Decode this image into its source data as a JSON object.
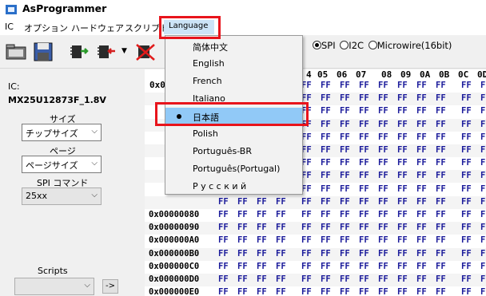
{
  "window": {
    "title": "AsProgrammer"
  },
  "menubar": {
    "items": [
      {
        "label": "IC"
      },
      {
        "label": "オプション"
      },
      {
        "label": "ハードウェア"
      },
      {
        "label": "スクリプト"
      }
    ],
    "language_label": "Language"
  },
  "language_menu": {
    "items": [
      {
        "label": "简体中文",
        "selected": false
      },
      {
        "label": "English",
        "selected": false
      },
      {
        "label": "French",
        "selected": false
      },
      {
        "label": "Italiano",
        "selected": false
      },
      {
        "label": "日本語",
        "selected": true
      },
      {
        "label": "Polish",
        "selected": false
      },
      {
        "label": "Português-BR",
        "selected": false
      },
      {
        "label": "Português(Portugal)",
        "selected": false
      },
      {
        "label": "Р у с с к и й",
        "selected": false
      }
    ]
  },
  "protocol": {
    "options": [
      {
        "label": "SPI",
        "checked": true
      },
      {
        "label": "I2C",
        "checked": false
      },
      {
        "label": "Microwire(16bit)",
        "checked": false
      }
    ]
  },
  "left_panel": {
    "ic_label": "IC:",
    "ic_name": "MX25U12873F_1.8V",
    "size_label": "サイズ",
    "size_value": "チップサイズ",
    "page_label": "ページ",
    "page_value": "ページサイズ",
    "spi_cmd_label": "SPI コマンド",
    "spi_cmd_value": "25xx",
    "scripts_label": "Scripts",
    "scripts_value": "",
    "run_label": "->"
  },
  "hex": {
    "partial_first_addr": "0x0",
    "header_visible": [
      "4",
      "05",
      "06",
      "07",
      "08",
      "09",
      "0A",
      "0B",
      "0C",
      "0D"
    ],
    "visible_addresses": [
      "0x00000080",
      "0x00000090",
      "0x000000A0",
      "0x000000B0",
      "0x000000C0",
      "0x000000D0",
      "0x000000E0"
    ],
    "byte_value": "FF"
  },
  "colors": {
    "highlight_red": "#e8141c",
    "selection_blue": "#91c9f7",
    "menu_hover": "#cce4f7",
    "hex_text": "#1a1a9a"
  },
  "icons": {
    "toolbar": [
      "open-folder-icon",
      "save-floppy-icon",
      "read-chip-icon",
      "write-chip-icon",
      "erase-chip-icon"
    ],
    "app": "app-logo-icon"
  }
}
